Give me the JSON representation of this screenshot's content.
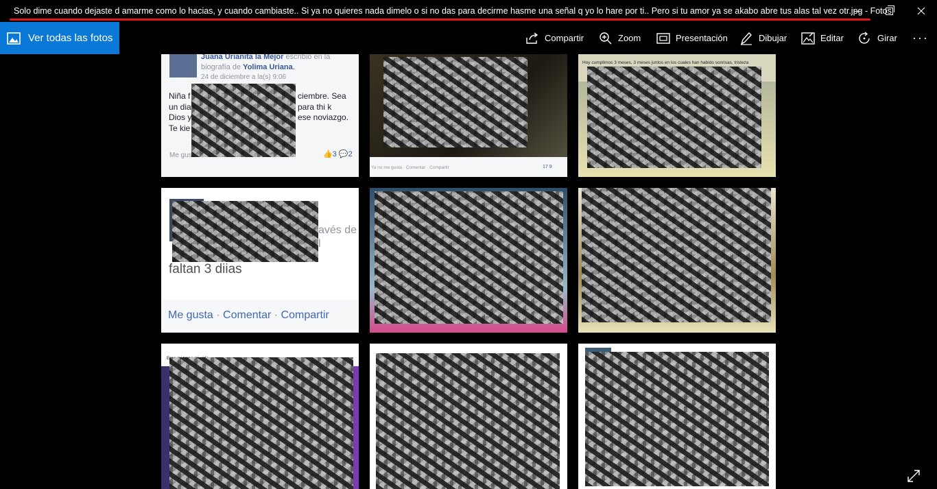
{
  "window": {
    "title": "Solo dime cuando dejaste d amarme como lo hacias, y cuando cambiaste.. Si ya no quieres nada dimelo o si no das para decirme hasme una señal q yo lo hare por ti.. Pero si tu amor ya se akabo  abre tus alas tal vez otr.jpg - Fotos",
    "accent_underline": "#e0151d"
  },
  "toolbar": {
    "see_all": "Ver todas las fotos",
    "share": "Compartir",
    "zoom": "Zoom",
    "slideshow": "Presentación",
    "draw": "Dibujar",
    "edit": "Editar",
    "rotate": "Girar",
    "more": "···",
    "accent": "#0a78d7"
  },
  "collage": {
    "cell1": {
      "author": "Juana Urianita la Mejor",
      "wrote_on": "escribió en la",
      "biography_of": "biografía de",
      "target": "Yolima Uriana",
      "time": "24 de diciembre a la(s) 9:06",
      "lines": [
        "Niña f",
        "un dia",
        "Dios y",
        "Te kie"
      ],
      "lines_right": [
        "ciembre. Sea",
        "para thi k",
        "ese noviazgo."
      ],
      "like": "Me gus",
      "likes_count": "3",
      "comments_count": "2"
    },
    "cell2": {
      "footer": "Ya no me gusta · Comentar · Compartir",
      "likes_count": "17",
      "comments_count": "9"
    },
    "cell3": {
      "text": "Hoy cumplimos 3 meses, 3 meses juntos en los cuales han habido sonrisas, tristeza"
    },
    "cell4": {
      "partial": "avés de l",
      "big_text": "faltan 3 diias",
      "actions": [
        "Me gusta",
        "Comentar",
        "Compartir"
      ]
    },
    "cell7": {
      "text": "Eres mi trono mi vida"
    }
  },
  "icons": {
    "see_all": "photos-icon",
    "share": "share-icon",
    "zoom": "zoom-icon",
    "slideshow": "slideshow-icon",
    "draw": "draw-icon",
    "edit": "edit-icon",
    "rotate": "rotate-icon",
    "fullscreen": "expand-icon"
  }
}
